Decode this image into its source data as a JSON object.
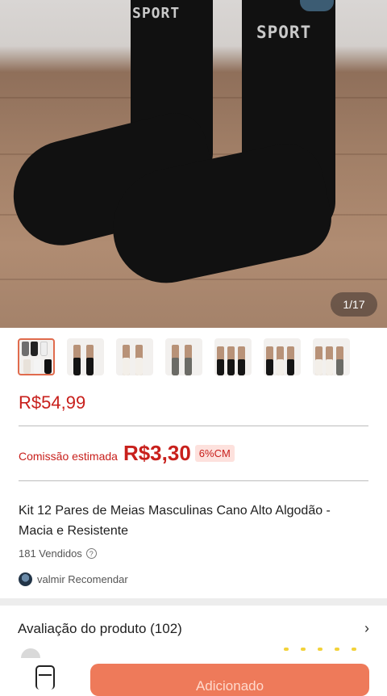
{
  "gallery": {
    "counter": "1/17",
    "sock_text_left": "SPORT",
    "sock_text_right": "SPORT",
    "thumbnail_count": 7
  },
  "product": {
    "price": "R$54,99",
    "commission_label": "Comissão estimada",
    "commission_value": "R$3,30",
    "commission_badge": "6%CM",
    "title": "Kit 12 Pares de Meias Masculinas Cano Alto Algodão - Macia e Resistente",
    "sold": "181 Vendidos",
    "recommender": "valmir Recomendar"
  },
  "reviews": {
    "title": "Avaliação do produto (102)"
  },
  "bottom": {
    "add_button": "Adicionado"
  },
  "colors": {
    "price_red": "#c8201c",
    "button_orange": "#ee7a5a"
  },
  "icons": {
    "help": "help-circle-icon",
    "chevron": "chevron-right-icon",
    "cart": "cart-icon"
  }
}
